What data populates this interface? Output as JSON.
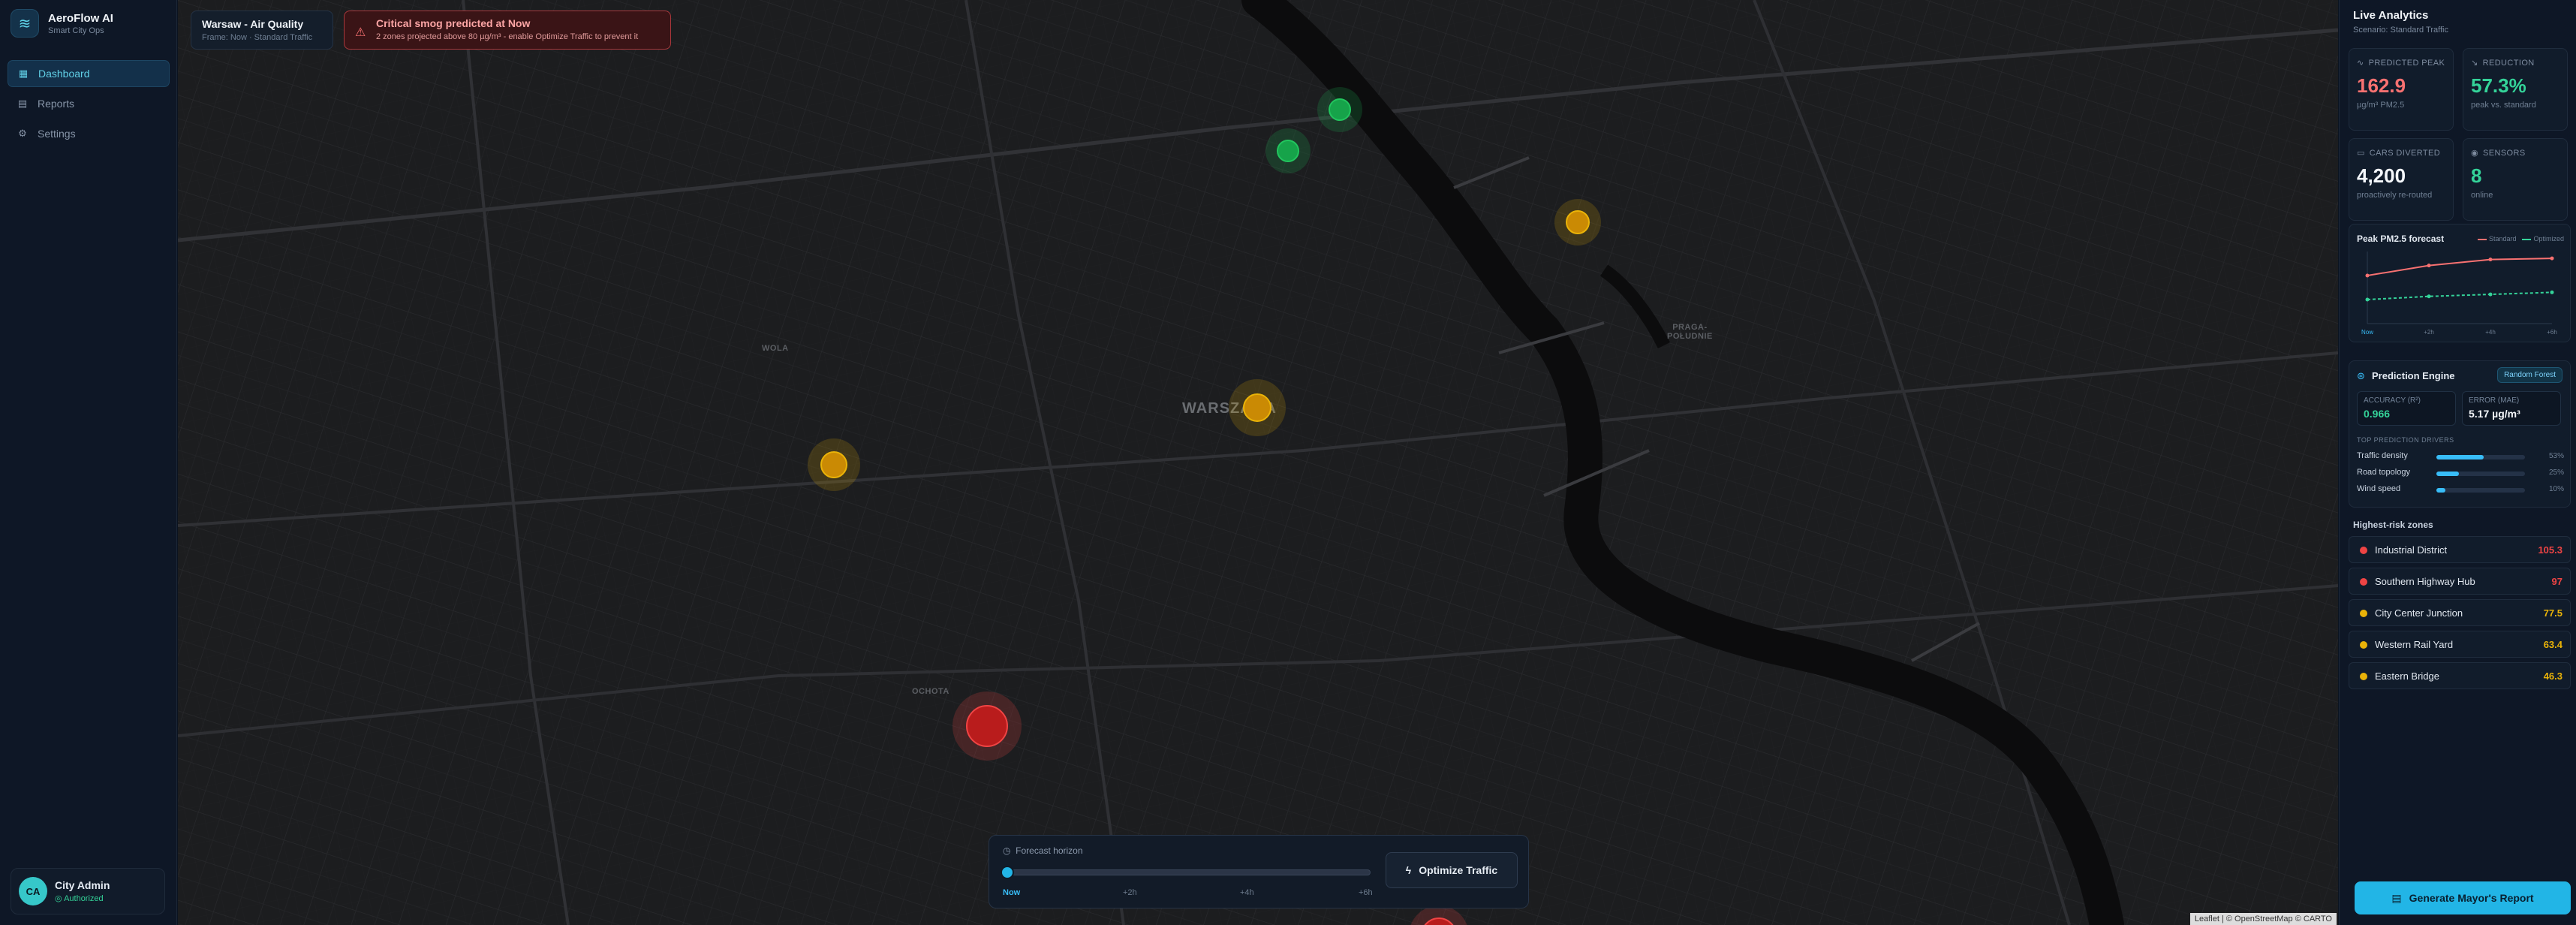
{
  "brand": {
    "name": "AeroFlow AI",
    "subtitle": "Smart City Ops",
    "icon": "wind-icon"
  },
  "nav": [
    {
      "label": "Dashboard",
      "icon": "dashboard-icon",
      "active": true
    },
    {
      "label": "Reports",
      "icon": "document-icon",
      "active": false
    },
    {
      "label": "Settings",
      "icon": "gear-icon",
      "active": false
    }
  ],
  "user": {
    "initials": "CA",
    "name": "City Admin",
    "status": "Authorized"
  },
  "map": {
    "title": "Warsaw - Air Quality",
    "frame": "Frame: Now · Standard Traffic",
    "alert_title": "Critical smog predicted at Now",
    "alert_text": "2 zones projected above 80 µg/m³ - enable Optimize Traffic to prevent it",
    "labels": {
      "city": "WARSZAWA",
      "wola": "WOLA",
      "ochota": "OCHOTA",
      "praga": "PRAGA-\nPOŁUDNIE"
    },
    "attribution": "Leaflet | © OpenStreetMap © CARTO",
    "colors": {
      "green": "#22c55e",
      "amber": "#eab308",
      "red": "#ef4444"
    }
  },
  "forecast": {
    "label": "Forecast horizon",
    "ticks": [
      "Now",
      "+2h",
      "+4h",
      "+6h"
    ],
    "value": 0,
    "optimize_label": "Optimize Traffic"
  },
  "panel": {
    "title": "Live Analytics",
    "scenario": "Scenario: Standard Traffic",
    "kpis": {
      "peak": {
        "label": "PREDICTED PEAK",
        "value": "162.9",
        "note": "µg/m³ PM2.5"
      },
      "reduction": {
        "label": "REDUCTION",
        "value": "57.3%",
        "note": "peak vs. standard"
      },
      "cars": {
        "label": "CARS DIVERTED",
        "value": "4,200",
        "note": "proactively re-routed"
      },
      "sensors": {
        "label": "SENSORS",
        "value": "8",
        "note": "online"
      }
    },
    "chart_title": "Peak PM2.5 forecast",
    "legend_standard": "Standard",
    "legend_optimized": "Optimized",
    "engine": {
      "title": "Prediction Engine",
      "badge": "Random Forest",
      "accuracy_label": "ACCURACY (R²)",
      "accuracy_value": "0.966",
      "error_label": "ERROR (MAE)",
      "error_value": "5.17 µg/m³",
      "drivers_header": "TOP PREDICTION DRIVERS",
      "drivers": [
        {
          "name": "Traffic density",
          "pct": "53%",
          "value": 53
        },
        {
          "name": "Road topology",
          "pct": "25%",
          "value": 25
        },
        {
          "name": "Wind speed",
          "pct": "10%",
          "value": 10
        }
      ]
    },
    "risk_header": "Highest-risk zones",
    "risks": [
      {
        "name": "Industrial District",
        "value": "105.3",
        "level": "red"
      },
      {
        "name": "Southern Highway Hub",
        "value": "97",
        "level": "red"
      },
      {
        "name": "City Center Junction",
        "value": "77.5",
        "level": "amber"
      },
      {
        "name": "Western Rail Yard",
        "value": "63.4",
        "level": "amber"
      },
      {
        "name": "Eastern Bridge",
        "value": "46.3",
        "level": "amber"
      }
    ],
    "generate_label": "Generate Mayor's Report"
  },
  "chart_data": {
    "type": "line",
    "title": "Peak PM2.5 forecast",
    "categories": [
      "Now",
      "+2h",
      "+4h",
      "+6h"
    ],
    "series": [
      {
        "name": "Standard",
        "values": [
          120,
          145,
          160,
          163
        ],
        "color": "#f87171"
      },
      {
        "name": "Optimized",
        "values": [
          60,
          68,
          73,
          78
        ],
        "color": "#34d399"
      }
    ],
    "ylim": [
      0,
      180
    ],
    "grid": false,
    "legend": "top-right"
  }
}
